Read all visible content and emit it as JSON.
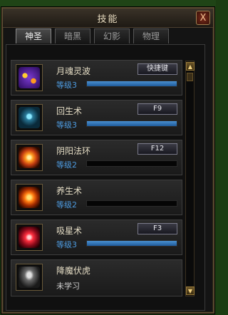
{
  "window": {
    "title": "技能",
    "close_label": "X"
  },
  "tabs": [
    {
      "label": "神圣",
      "active": true
    },
    {
      "label": "暗黑",
      "active": false
    },
    {
      "label": "幻影",
      "active": false
    },
    {
      "label": "物理",
      "active": false
    }
  ],
  "skills": [
    {
      "name": "月魂灵波",
      "level_text": "等级3",
      "progress": 1.0,
      "hotkey": "快捷键",
      "icon": "purple-orb-icon"
    },
    {
      "name": "回生术",
      "level_text": "等级3",
      "progress": 1.0,
      "hotkey": "F9",
      "icon": "blue-idol-icon"
    },
    {
      "name": "阴阳法环",
      "level_text": "等级2",
      "progress": 0.0,
      "hotkey": "F12",
      "icon": "fire-sun-icon"
    },
    {
      "name": "养生术",
      "level_text": "等级2",
      "progress": 0.0,
      "hotkey": "",
      "icon": "fire-swirl-icon"
    },
    {
      "name": "吸星术",
      "level_text": "等级3",
      "progress": 1.0,
      "hotkey": "F3",
      "icon": "red-star-icon"
    },
    {
      "name": "降魔伏虎",
      "level_text": "",
      "status": "未学习",
      "icon": "grey-figure-icon"
    }
  ],
  "colors": {
    "accent": "#4d9be0",
    "frame": "#5a4a30"
  }
}
